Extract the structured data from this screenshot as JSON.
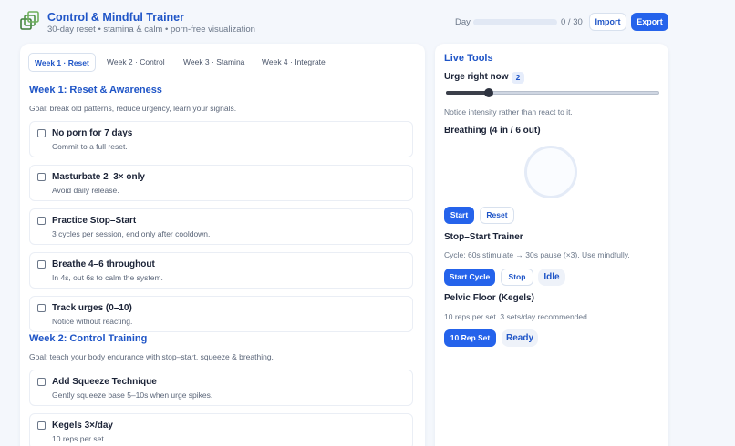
{
  "header": {
    "title": "Control & Mindful Trainer",
    "subtitle": "30-day reset • stamina & calm • porn-free visualization",
    "day_label": "Day",
    "day_count": "0 / 30",
    "day_progress": 0,
    "import_label": "Import",
    "export_label": "Export",
    "logo_icon": "stacked-squares-icon"
  },
  "tabs": [
    {
      "label": "Week 1 · Reset",
      "active": true
    },
    {
      "label": "Week 2 · Control",
      "active": false
    },
    {
      "label": "Week 3 · Stamina",
      "active": false
    },
    {
      "label": "Week 4 · Integrate",
      "active": false
    }
  ],
  "weeks": [
    {
      "heading": "Week 1: Reset & Awareness",
      "goal": "Goal: break old patterns, reduce urgency, learn your signals.",
      "items": [
        {
          "title": "No porn for 7 days",
          "desc": "Commit to a full reset.",
          "checked": false
        },
        {
          "title": "Masturbate 2–3× only",
          "desc": "Avoid daily release.",
          "checked": false
        },
        {
          "title": "Practice Stop–Start",
          "desc": "3 cycles per session, end only after cooldown.",
          "checked": false
        },
        {
          "title": "Breathe 4–6 throughout",
          "desc": "In 4s, out 6s to calm the system.",
          "checked": false
        },
        {
          "title": "Track urges (0–10)",
          "desc": "Notice without reacting.",
          "checked": false
        }
      ]
    },
    {
      "heading": "Week 2: Control Training",
      "goal": "Goal: teach your body endurance with stop–start, squeeze & breathing.",
      "items": [
        {
          "title": "Add Squeeze Technique",
          "desc": "Gently squeeze base 5–10s when urge spikes.",
          "checked": false
        },
        {
          "title": "Kegels 3×/day",
          "desc": "10 reps per set.",
          "checked": false
        }
      ]
    }
  ],
  "tools": {
    "title": "Live Tools",
    "urge": {
      "label": "Urge right now",
      "value": "2",
      "level": 2,
      "min": 0,
      "max": 10
    },
    "urge_hint": "Notice intensity rather than react to it.",
    "breathing": {
      "label": "Breathing (4 in / 6 out)",
      "start_label": "Start",
      "reset_label": "Reset"
    },
    "stop_start": {
      "label": "Stop–Start Trainer",
      "desc": "Cycle: 60s stimulate → 30s pause (×3). Use mindfully.",
      "start_label": "Start Cycle",
      "stop_label": "Stop",
      "status": "Idle"
    },
    "kegels": {
      "label": "Pelvic Floor (Kegels)",
      "desc": "10 reps per set. 3 sets/day recommended.",
      "button_label": "10 Rep Set",
      "status": "Ready"
    }
  },
  "colors": {
    "accent": "#2563eb",
    "heading": "#1f55c7",
    "background": "#f4f7fc"
  }
}
